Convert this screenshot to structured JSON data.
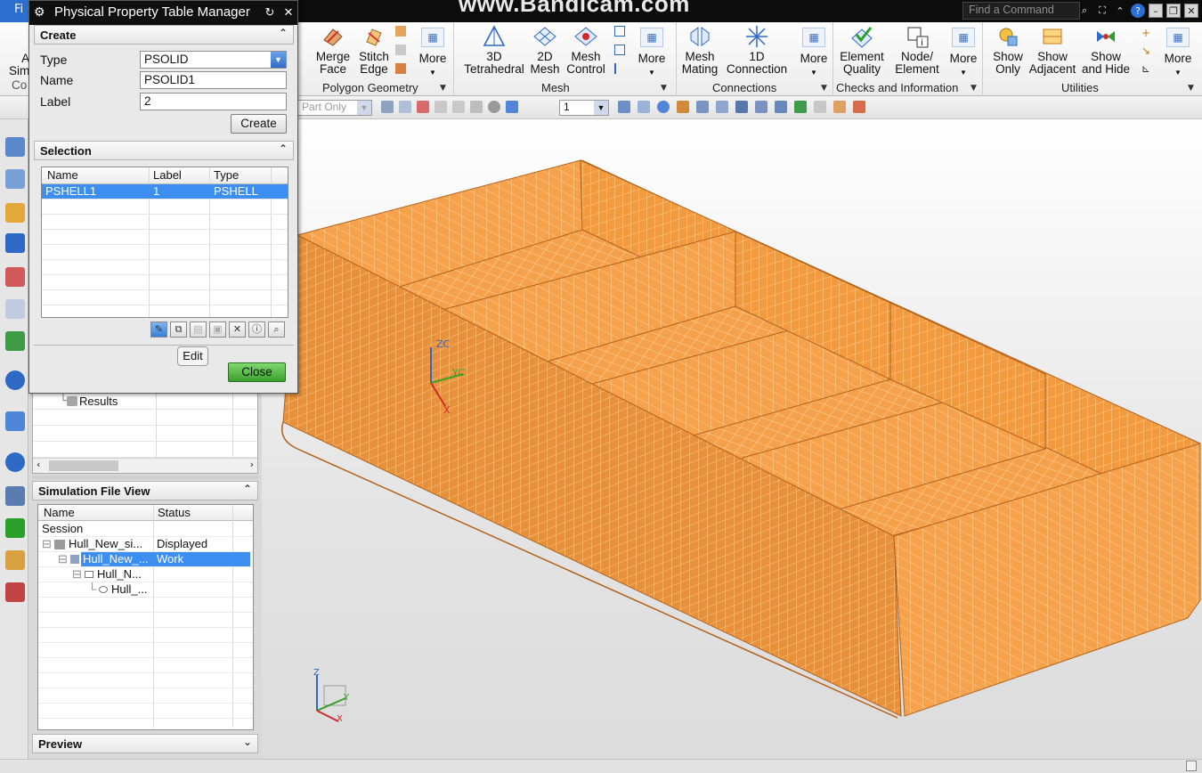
{
  "app": {
    "file_tab": "Fi",
    "watermark": "www.Bandicam.com",
    "find_command_placeholder": "Find a Command"
  },
  "ribbon": {
    "groups": [
      {
        "label": "Polygon Geometry",
        "buttons": [
          {
            "l1": "Merge",
            "l2": "Face"
          },
          {
            "l1": "Stitch",
            "l2": "Edge"
          },
          {
            "l1": "More",
            "l2": ""
          }
        ]
      },
      {
        "label": "Mesh",
        "buttons": [
          {
            "l1": "3D",
            "l2": "Tetrahedral"
          },
          {
            "l1": "2D",
            "l2": "Mesh"
          },
          {
            "l1": "Mesh",
            "l2": "Control"
          },
          {
            "l1": "More",
            "l2": ""
          }
        ]
      },
      {
        "label": "Connections",
        "buttons": [
          {
            "l1": "Mesh",
            "l2": "Mating"
          },
          {
            "l1": "1D",
            "l2": "Connection"
          },
          {
            "l1": "More",
            "l2": ""
          }
        ]
      },
      {
        "label": "Checks and Information",
        "buttons": [
          {
            "l1": "Element",
            "l2": "Quality"
          },
          {
            "l1": "Node/",
            "l2": "Element"
          },
          {
            "l1": "More",
            "l2": ""
          }
        ]
      },
      {
        "label": "Utilities",
        "buttons": [
          {
            "l1": "Show",
            "l2": "Only"
          },
          {
            "l1": "Show",
            "l2": "Adjacent"
          },
          {
            "l1": "Show",
            "l2": "and Hide"
          },
          {
            "l1": "More",
            "l2": ""
          }
        ]
      }
    ],
    "left_partial": {
      "l1": "A",
      "l2": "Sim",
      "l3": "Co"
    }
  },
  "toolbar": {
    "part_filter": "Part Only",
    "layer_select": "1"
  },
  "dialog": {
    "title": "Physical Property Table Manager",
    "create_section": "Create",
    "type_label": "Type",
    "type_value": "PSOLID",
    "name_label": "Name",
    "name_value": "PSOLID1",
    "label_label": "Label",
    "label_value": "2",
    "create_button": "Create",
    "selection_section": "Selection",
    "columns": [
      "Name",
      "Label",
      "Type"
    ],
    "rows": [
      {
        "name": "PSHELL1",
        "label": "1",
        "type": "PSHELL"
      }
    ],
    "tooltip": "Edit",
    "close_button": "Close"
  },
  "navigator": {
    "results_label": "Results"
  },
  "sim_file_view": {
    "title": "Simulation File View",
    "columns": [
      "Name",
      "Status"
    ],
    "rows": [
      {
        "name": "Session",
        "status": ""
      },
      {
        "name": "Hull_New_si...",
        "status": "Displayed"
      },
      {
        "name": "Hull_New_...",
        "status": "Work"
      },
      {
        "name": "Hull_N...",
        "status": ""
      },
      {
        "name": "Hull_...",
        "status": ""
      }
    ]
  },
  "preview": {
    "title": "Preview"
  },
  "colors": {
    "mesh_fill": "#f7a24a",
    "mesh_line": "#ffd39a",
    "selection_blue": "#3c8ff0"
  }
}
